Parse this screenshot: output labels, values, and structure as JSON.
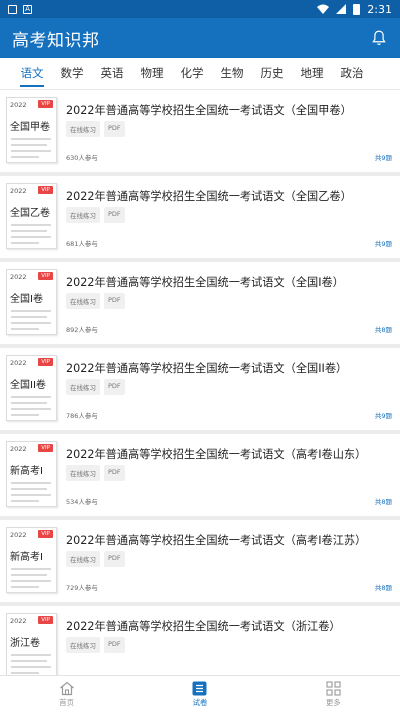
{
  "status_bar": {
    "left_icons": [
      "image-icon",
      "a-icon"
    ],
    "time": "2:31"
  },
  "app": {
    "title": "高考知识邦"
  },
  "tabs": [
    {
      "label": "语文",
      "active": true
    },
    {
      "label": "数学",
      "active": false
    },
    {
      "label": "英语",
      "active": false
    },
    {
      "label": "物理",
      "active": false
    },
    {
      "label": "化学",
      "active": false
    },
    {
      "label": "生物",
      "active": false
    },
    {
      "label": "历史",
      "active": false
    },
    {
      "label": "地理",
      "active": false
    },
    {
      "label": "政治",
      "active": false
    }
  ],
  "papers": [
    {
      "thumb_year": "2022",
      "thumb_badge": "VIP",
      "thumb_name": "全国甲卷",
      "title": "2022年普通高等学校招生全国统一考试语文（全国甲卷）",
      "tags": [
        "在线练习",
        "PDF"
      ],
      "participants": "630人参与",
      "total": "共9题"
    },
    {
      "thumb_year": "2022",
      "thumb_badge": "VIP",
      "thumb_name": "全国乙卷",
      "title": "2022年普通高等学校招生全国统一考试语文（全国乙卷）",
      "tags": [
        "在线练习",
        "PDF"
      ],
      "participants": "681人参与",
      "total": "共9题"
    },
    {
      "thumb_year": "2022",
      "thumb_badge": "VIP",
      "thumb_name": "全国I卷",
      "title": "2022年普通高等学校招生全国统一考试语文（全国I卷）",
      "tags": [
        "在线练习",
        "PDF"
      ],
      "participants": "892人参与",
      "total": "共8题"
    },
    {
      "thumb_year": "2022",
      "thumb_badge": "VIP",
      "thumb_name": "全国II卷",
      "title": "2022年普通高等学校招生全国统一考试语文（全国II卷）",
      "tags": [
        "在线练习",
        "PDF"
      ],
      "participants": "786人参与",
      "total": "共9题"
    },
    {
      "thumb_year": "2022",
      "thumb_badge": "VIP",
      "thumb_name": "新高考I",
      "title": "2022年普通高等学校招生全国统一考试语文（高考I卷山东）",
      "tags": [
        "在线练习",
        "PDF"
      ],
      "participants": "534人参与",
      "total": "共8题"
    },
    {
      "thumb_year": "2022",
      "thumb_badge": "VIP",
      "thumb_name": "新高考I",
      "title": "2022年普通高等学校招生全国统一考试语文（高考I卷江苏）",
      "tags": [
        "在线练习",
        "PDF"
      ],
      "participants": "729人参与",
      "total": "共8题"
    },
    {
      "thumb_year": "2022",
      "thumb_badge": "VIP",
      "thumb_name": "浙江卷",
      "title": "2022年普通高等学校招生全国统一考试语文（浙江卷）",
      "tags": [
        "在线练习",
        "PDF"
      ],
      "participants": "",
      "total": ""
    }
  ],
  "bottom_nav": [
    {
      "label": "首页",
      "icon": "home-icon",
      "active": false
    },
    {
      "label": "试卷",
      "icon": "paper-icon",
      "active": true
    },
    {
      "label": "更多",
      "icon": "grid-icon",
      "active": false
    }
  ],
  "colors": {
    "primary": "#1570be",
    "statusbar": "#0f5fa6",
    "vip": "#e84545"
  }
}
